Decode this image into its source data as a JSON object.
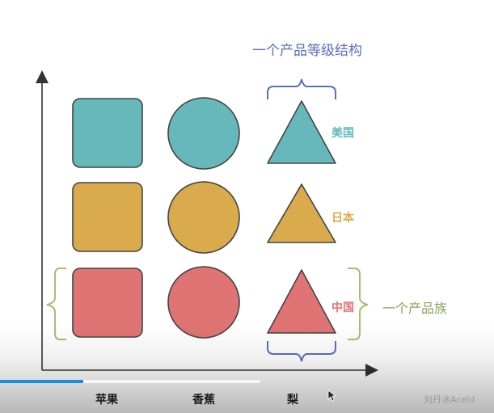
{
  "header": {
    "level_label": "一个产品等级结构"
  },
  "side": {
    "family_label": "一个产品族"
  },
  "rows": [
    {
      "name": "美国",
      "color": "#66b8bb"
    },
    {
      "name": "日本",
      "color": "#d9ab4c"
    },
    {
      "name": "中国",
      "color": "#e07474"
    }
  ],
  "columns": [
    "苹果",
    "香蕉",
    "梨"
  ],
  "shapes": [
    "square",
    "circle",
    "triangle"
  ],
  "accent_colors": {
    "blue_brace": "#5a6fc0",
    "green_brace": "#a6bd72",
    "axis": "#333333"
  },
  "video": {
    "progress_fraction": 0.32
  },
  "watermark": "刘丹冰Aceld"
}
